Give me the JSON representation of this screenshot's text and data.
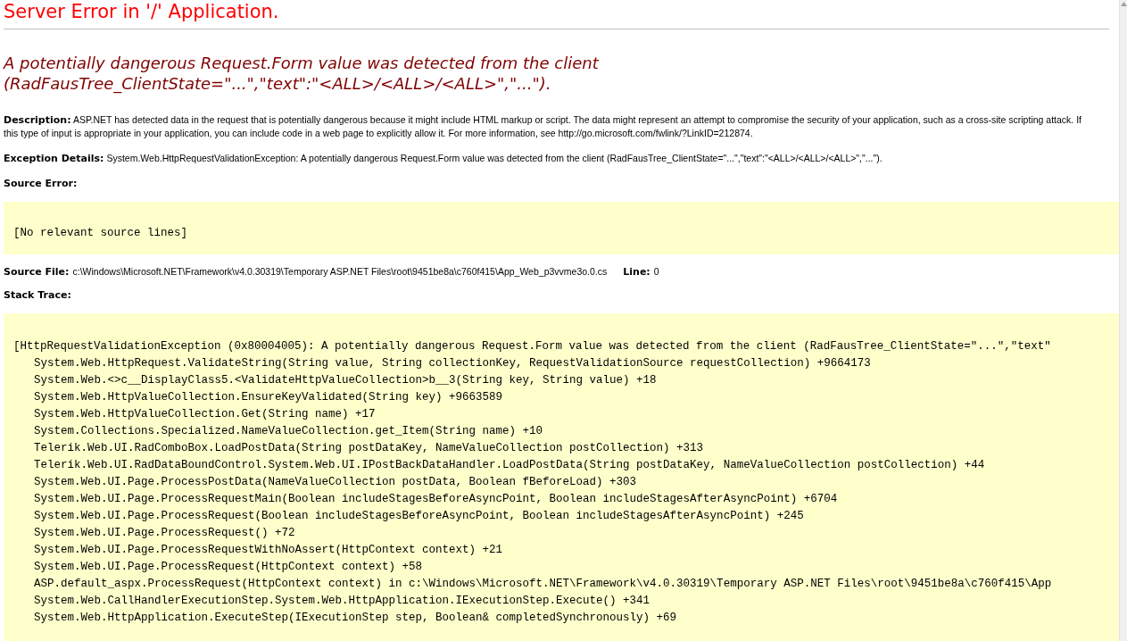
{
  "title": "Server Error in '/' Application.",
  "error_heading": "A potentially dangerous Request.Form value was detected from the client\n(RadFausTree_ClientState=\"...\",\"text\":\"<ALL>/<ALL>/<ALL>\",\"...\").",
  "description": {
    "label": "Description:",
    "text": "ASP.NET has detected data in the request that is potentially dangerous because it might include HTML markup or script. The data might represent an attempt to compromise the security of your application, such as a cross-site scripting attack. If this type of input is appropriate in your application, you can include code in a web page to explicitly allow it. For more information, see http://go.microsoft.com/fwlink/?LinkID=212874."
  },
  "exception_details": {
    "label": "Exception Details:",
    "text": "System.Web.HttpRequestValidationException: A potentially dangerous Request.Form value was detected from the client (RadFausTree_ClientState=\"...\",\"text\":\"<ALL>/<ALL>/<ALL>\",\"...\")."
  },
  "source_error": {
    "label": "Source Error:",
    "lines": [
      "[No relevant source lines]"
    ]
  },
  "source_file": {
    "label": "Source File:",
    "path": "c:\\Windows\\Microsoft.NET\\Framework\\v4.0.30319\\Temporary ASP.NET Files\\root\\9451be8a\\c760f415\\App_Web_p3vvme3o.0.cs",
    "line_label": "Line:",
    "line": "0"
  },
  "stack_trace": {
    "label": "Stack Trace:",
    "lines": [
      {
        "kind": "exception",
        "text": "[HttpRequestValidationException (0x80004005): A potentially dangerous Request.Form value was detected from the client (RadFausTree_ClientState=\"...\",\"text\""
      },
      {
        "kind": "frame",
        "text": "System.Web.HttpRequest.ValidateString(String value, String collectionKey, RequestValidationSource requestCollection) +9664173"
      },
      {
        "kind": "frame",
        "text": "System.Web.<>c__DisplayClass5.<ValidateHttpValueCollection>b__3(String key, String value) +18"
      },
      {
        "kind": "frame",
        "text": "System.Web.HttpValueCollection.EnsureKeyValidated(String key) +9663589"
      },
      {
        "kind": "frame",
        "text": "System.Web.HttpValueCollection.Get(String name) +17"
      },
      {
        "kind": "frame",
        "text": "System.Collections.Specialized.NameValueCollection.get_Item(String name) +10"
      },
      {
        "kind": "frame",
        "text": "Telerik.Web.UI.RadComboBox.LoadPostData(String postDataKey, NameValueCollection postCollection) +313"
      },
      {
        "kind": "frame",
        "text": "Telerik.Web.UI.RadDataBoundControl.System.Web.UI.IPostBackDataHandler.LoadPostData(String postDataKey, NameValueCollection postCollection) +44"
      },
      {
        "kind": "frame",
        "text": "System.Web.UI.Page.ProcessPostData(NameValueCollection postData, Boolean fBeforeLoad) +303"
      },
      {
        "kind": "frame",
        "text": "System.Web.UI.Page.ProcessRequestMain(Boolean includeStagesBeforeAsyncPoint, Boolean includeStagesAfterAsyncPoint) +6704"
      },
      {
        "kind": "frame",
        "text": "System.Web.UI.Page.ProcessRequest(Boolean includeStagesBeforeAsyncPoint, Boolean includeStagesAfterAsyncPoint) +245"
      },
      {
        "kind": "frame",
        "text": "System.Web.UI.Page.ProcessRequest() +72"
      },
      {
        "kind": "frame",
        "text": "System.Web.UI.Page.ProcessRequestWithNoAssert(HttpContext context) +21"
      },
      {
        "kind": "frame",
        "text": "System.Web.UI.Page.ProcessRequest(HttpContext context) +58"
      },
      {
        "kind": "frame",
        "text": "ASP.default_aspx.ProcessRequest(HttpContext context) in c:\\Windows\\Microsoft.NET\\Framework\\v4.0.30319\\Temporary ASP.NET Files\\root\\9451be8a\\c760f415\\App"
      },
      {
        "kind": "frame",
        "text": "System.Web.CallHandlerExecutionStep.System.Web.HttpApplication.IExecutionStep.Execute() +341"
      },
      {
        "kind": "frame",
        "text": "System.Web.HttpApplication.ExecuteStep(IExecutionStep step, Boolean& completedSynchronously) +69"
      }
    ]
  }
}
